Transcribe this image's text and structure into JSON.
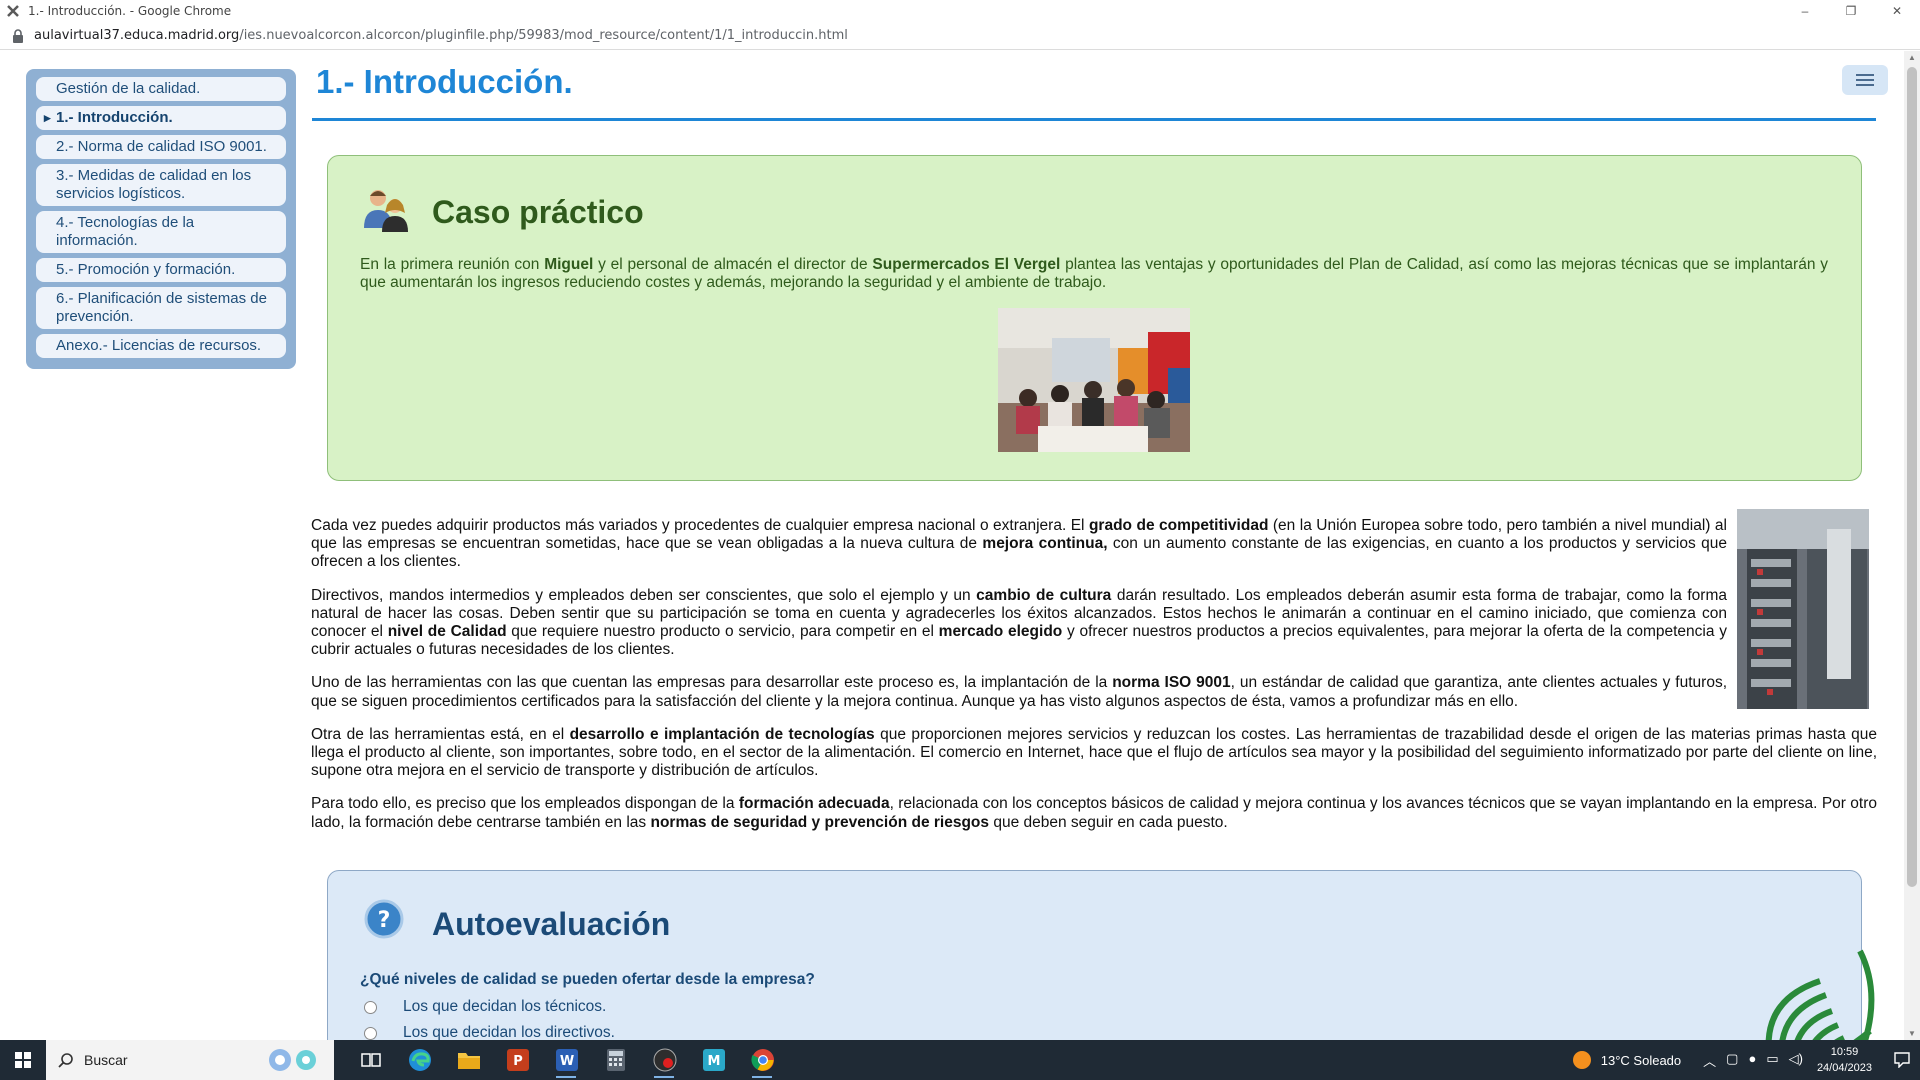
{
  "window": {
    "title": "1.- Introducción. - Google Chrome",
    "minimize": "–",
    "restore": "❐",
    "close": "✕"
  },
  "address": {
    "host": "aulavirtual37.educa.madrid.org",
    "path": "/ies.nuevoalcorcon.alcorcon/pluginfile.php/59983/mod_resource/content/1/1_introduccin.html"
  },
  "sidebar": {
    "items": [
      {
        "label": "Gestión de la calidad."
      },
      {
        "label": "1.- Introducción."
      },
      {
        "label": "2.- Norma de calidad ISO 9001."
      },
      {
        "label": "3.- Medidas de calidad en los servicios logísticos."
      },
      {
        "label": "4.- Tecnologías de la información."
      },
      {
        "label": "5.- Promoción y formación."
      },
      {
        "label": "6.- Planificación de sistemas de prevención."
      },
      {
        "label": "Anexo.- Licencias de recursos."
      }
    ]
  },
  "page": {
    "title": "1.- Introducción."
  },
  "caso": {
    "heading": "Caso práctico",
    "t1": "En la primera reunión con ",
    "b1": "Miguel",
    "t2": " y el personal de almacén el director de ",
    "b2": "Supermercados El Vergel",
    "t3": " plantea las ventajas y oportunidades del Plan de Calidad, así como las mejoras técnicas que se implantarán y que aumentarán los ingresos reduciendo costes y además, mejorando la seguridad y el ambiente de trabajo."
  },
  "body": {
    "p1": {
      "t1": "Cada vez puedes adquirir productos más variados y procedentes de cualquier empresa nacional o extranjera. El ",
      "b1": "grado de competitividad",
      "t2": " (en la Unión Europea sobre todo, pero también a nivel mundial) al que las empresas se encuentran sometidas, hace que se vean obligadas a la nueva cultura de ",
      "b2": "mejora continua,",
      "t3": " con un aumento constante de las exigencias, en cuanto a los productos y servicios que ofrecen a los clientes."
    },
    "p2": {
      "t1": "Directivos, mandos intermedios y empleados deben ser conscientes, que solo el ejemplo y un ",
      "b1": "cambio de cultura",
      "t2": " darán resultado. Los empleados deberán asumir esta forma de trabajar, como la forma natural de hacer las cosas. Deben sentir que su participación se toma en cuenta y agradecerles los éxitos alcanzados. Estos hechos le animarán a continuar en el camino iniciado, que comienza con conocer el ",
      "b2": "nivel de Calidad",
      "t3": " que requiere nuestro producto o servicio, para competir en el ",
      "b3": "mercado elegido",
      "t4": " y ofrecer nuestros productos a precios equivalentes, para mejorar la oferta de la competencia y cubrir actuales o futuras necesidades de los clientes."
    },
    "p3": {
      "t1": "Uno de las herramientas con las que cuentan las empresas para desarrollar este proceso es, la implantación de la ",
      "b1": "norma ISO 9001",
      "t2": ", un estándar de calidad que garantiza, ante clientes actuales y futuros, que se siguen procedimientos certificados para la satisfacción del cliente y la mejora continua. Aunque ya has visto algunos aspectos de ésta, vamos a profundizar más en ello."
    },
    "p4": {
      "t1": "Otra de las herramientas está, en el ",
      "b1": "desarrollo e implantación de tecnologías",
      "t2": " que proporcionen mejores servicios y reduzcan los costes. Las herramientas de trazabilidad desde el origen de las materias primas hasta que llega el producto al cliente, son importantes, sobre todo, en el sector de la alimentación. El comercio en Internet, hace que el flujo de artículos sea mayor y la posibilidad del seguimiento informatizado por parte del cliente on line, supone otra mejora en el servicio de transporte y distribución de artículos."
    },
    "p5": {
      "t1": "Para todo ello, es preciso que los empleados dispongan de la ",
      "b1": "formación adecuada",
      "t2": ", relacionada con los conceptos básicos de calidad y mejora continua y los avances técnicos que se vayan implantando en la empresa. Por otro lado, la formación debe centrarse también en las ",
      "b2": "normas de seguridad y prevención de riesgos",
      "t3": " que deben seguir en cada puesto."
    }
  },
  "auto": {
    "heading": "Autoevaluación",
    "question": "¿Qué niveles de calidad se pueden ofertar desde la empresa?",
    "options": [
      {
        "label": "Los que decidan los técnicos."
      },
      {
        "label": "Los que decidan los directivos."
      }
    ]
  },
  "taskbar": {
    "search_label": "Buscar",
    "weather": "13°C  Soleado",
    "time": "10:59",
    "date": "24/04/2023"
  },
  "colors": {
    "accent": "#1e86d6",
    "caso_bg": "#d8f2c6",
    "auto_bg": "#dce9f7",
    "nav_bg": "#8fb0d3"
  }
}
